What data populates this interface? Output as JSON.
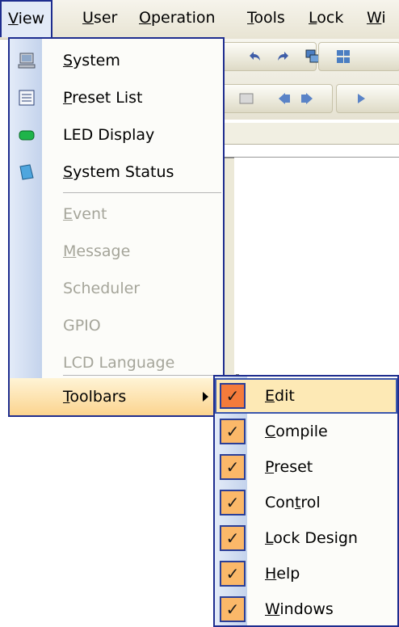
{
  "menubar": {
    "items": [
      {
        "name": "menu-view",
        "text": "View",
        "u": "V",
        "rest": "iew"
      },
      {
        "name": "menu-user",
        "text": "User",
        "u": "U",
        "rest": "ser"
      },
      {
        "name": "menu-operation",
        "text": "Operation",
        "u": "O",
        "rest": "peration"
      },
      {
        "name": "menu-tools",
        "text": "Tools",
        "u": "T",
        "rest": "ools"
      },
      {
        "name": "menu-lock",
        "text": "Lock",
        "u": "L",
        "rest": "ock"
      },
      {
        "name": "menu-window",
        "text": "Wi",
        "u": "W",
        "rest": "i"
      }
    ]
  },
  "view_menu": {
    "system": {
      "pre": "",
      "u": "S",
      "post": "ystem",
      "icon": "computer-icon"
    },
    "preset_list": {
      "pre": "",
      "u": "P",
      "post": "reset List",
      "icon": "list-icon"
    },
    "led_display": {
      "pre": "LED Display",
      "u": "",
      "post": "",
      "icon": "led-icon"
    },
    "system_status": {
      "pre": "",
      "u": "S",
      "post": "ystem Status",
      "icon": "status-icon"
    },
    "event": {
      "pre": "",
      "u": "E",
      "post": "vent"
    },
    "message": {
      "pre": "",
      "u": "M",
      "post": "essage"
    },
    "scheduler": {
      "pre": "Scheduler",
      "u": "",
      "post": ""
    },
    "gpio": {
      "pre": "GPIO",
      "u": "",
      "post": ""
    },
    "lcd_language": {
      "pre": "LCD Language",
      "u": "",
      "post": ""
    },
    "toolbars": {
      "pre": "",
      "u": "T",
      "post": "oolbars"
    }
  },
  "toolbars_menu": {
    "check_glyph": "✓",
    "edit": {
      "pre": "",
      "u": "E",
      "post": "dit"
    },
    "compile": {
      "pre": "",
      "u": "C",
      "post": "ompile"
    },
    "preset": {
      "pre": "",
      "u": "P",
      "post": "reset"
    },
    "control": {
      "pre": "Con",
      "u": "t",
      "post": "rol"
    },
    "lock_design": {
      "pre": "",
      "u": "L",
      "post": "ock Design"
    },
    "help": {
      "pre": "",
      "u": "H",
      "post": "elp"
    },
    "windows": {
      "pre": "",
      "u": "W",
      "post": "indows"
    }
  },
  "colors": {
    "menu_border": "#1e2d8f",
    "highlight": "#fbd48f",
    "check_bg": "#fbb869",
    "check_active": "#f47b3b",
    "disabled_text": "#a5a59a"
  }
}
